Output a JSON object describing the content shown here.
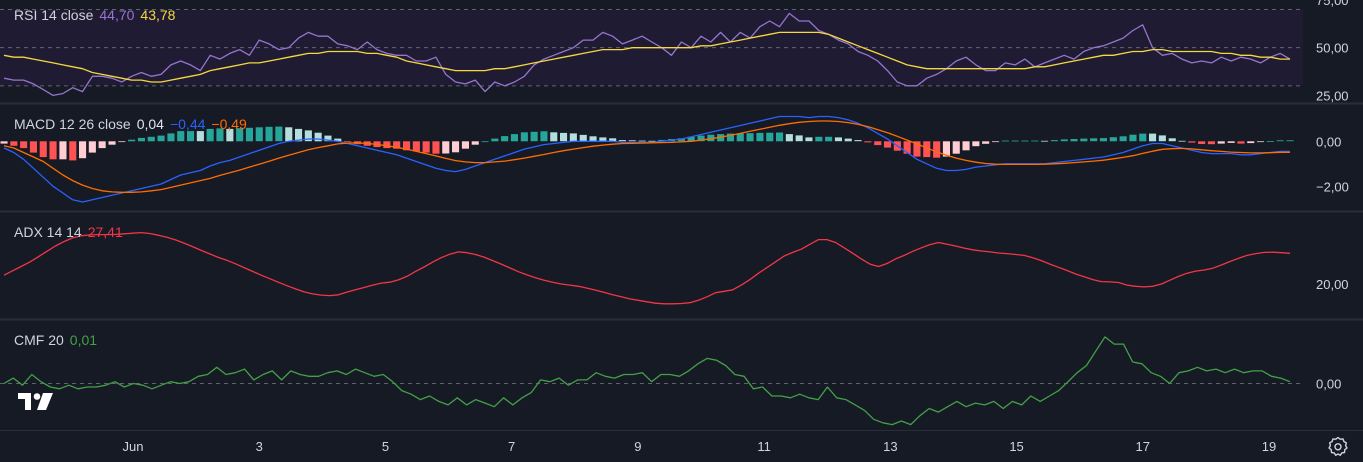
{
  "colors": {
    "background": "#161a25",
    "rsi_band": "#1f1b33",
    "rsi": "#9575cd",
    "rsi_ma": "#f5d93f",
    "macd": "#2962ff",
    "signal": "#ff6d00",
    "hist_pos_strong": "#26a69a",
    "hist_pos_weak": "#b2dfdb",
    "hist_neg_strong": "#ff5252",
    "hist_neg_weak": "#ffcdd2",
    "adx": "#f23645",
    "cmf": "#43a047",
    "axis_text": "#d1d4dc",
    "pane_divider": "#2a2e39"
  },
  "legends": {
    "rsi": {
      "name": "RSI 14 close",
      "v1": "44,70",
      "v2": "43,78"
    },
    "macd": {
      "name": "MACD 12 26 close",
      "v1": "0,04",
      "v2": "−0,44",
      "v3": "−0,49"
    },
    "adx": {
      "name": "ADX 14 14",
      "v1": "27,41"
    },
    "cmf": {
      "name": "CMF 20",
      "v1": "0,01"
    }
  },
  "icons": {
    "logo": "tradingview-logo-icon",
    "settings": "gear-icon"
  },
  "chart_data": [
    {
      "type": "line",
      "title": "RSI 14 close",
      "ylim": [
        21,
        75
      ],
      "y_ticks": [
        75,
        50,
        25
      ],
      "y_tick_labels": [
        "75,00",
        "50,00",
        "25,00"
      ],
      "bands": [
        70,
        50,
        30
      ],
      "series": [
        {
          "name": "RSI",
          "values": [
            34,
            33,
            33,
            31,
            28,
            25,
            26,
            29,
            27,
            35,
            35,
            34,
            32,
            35,
            37,
            35,
            36,
            41,
            43,
            41,
            38,
            46,
            44,
            47,
            49,
            46,
            54,
            52,
            49,
            50,
            55,
            58,
            56,
            56,
            52,
            51,
            49,
            53,
            49,
            47,
            46,
            46,
            43,
            43,
            45,
            36,
            32,
            31,
            33,
            27,
            32,
            30,
            32,
            35,
            41,
            44,
            46,
            48,
            50,
            54,
            54,
            58,
            56,
            52,
            54,
            56,
            53,
            50,
            46,
            53,
            50,
            56,
            53,
            58,
            53,
            58,
            55,
            61,
            64,
            61,
            68,
            64,
            64,
            59,
            57,
            54,
            52,
            48,
            46,
            43,
            38,
            32,
            30,
            30,
            34,
            36,
            39,
            43,
            45,
            41,
            38,
            38,
            42,
            41,
            44,
            40,
            42,
            44,
            46,
            44,
            48,
            50,
            51,
            53,
            55,
            59,
            62,
            50,
            46,
            47,
            44,
            42,
            43,
            42,
            45,
            43,
            45,
            44,
            42,
            45,
            47,
            44
          ]
        },
        {
          "name": "MA",
          "values": [
            46,
            45,
            45,
            44,
            43,
            42,
            41,
            40,
            39,
            37,
            36,
            35,
            34,
            33,
            33,
            32,
            32,
            33,
            34,
            35,
            36,
            38,
            39,
            40,
            41,
            42,
            42,
            43,
            44,
            45,
            46,
            47,
            47,
            48,
            48,
            48,
            48,
            47,
            47,
            46,
            45,
            43,
            42,
            41,
            40,
            39,
            38,
            38,
            38,
            38,
            39,
            39,
            40,
            41,
            42,
            43,
            44,
            45,
            46,
            47,
            48,
            49,
            49,
            49,
            50,
            50,
            50,
            50,
            50,
            50,
            50,
            51,
            51,
            52,
            53,
            54,
            55,
            56,
            57,
            58,
            58,
            58,
            58,
            58,
            57,
            55,
            53,
            51,
            49,
            47,
            45,
            43,
            41,
            40,
            39,
            39,
            39,
            39,
            39,
            39,
            39,
            39,
            39,
            39,
            39,
            40,
            40,
            41,
            42,
            43,
            44,
            45,
            46,
            46,
            47,
            48,
            48,
            49,
            49,
            48,
            48,
            48,
            48,
            48,
            47,
            47,
            46,
            46,
            45,
            45,
            44,
            44
          ]
        }
      ]
    },
    {
      "type": "line",
      "title": "MACD 12 26 close",
      "ylim": [
        -3.1,
        1.7
      ],
      "y_ticks": [
        0,
        -2
      ],
      "y_tick_labels": [
        "0,00",
        "−2,00"
      ],
      "series": [
        {
          "name": "MACD",
          "values": [
            -0.3,
            -0.5,
            -0.8,
            -1.2,
            -1.6,
            -2,
            -2.3,
            -2.6,
            -2.7,
            -2.6,
            -2.5,
            -2.4,
            -2.3,
            -2.2,
            -2.1,
            -2,
            -1.9,
            -1.7,
            -1.5,
            -1.4,
            -1.3,
            -1.1,
            -0.95,
            -0.85,
            -0.7,
            -0.55,
            -0.4,
            -0.25,
            -0.1,
            0.0,
            0.05,
            0.1,
            0.1,
            0.05,
            0.0,
            -0.1,
            -0.2,
            -0.3,
            -0.4,
            -0.5,
            -0.6,
            -0.75,
            -0.9,
            -1.05,
            -1.2,
            -1.3,
            -1.35,
            -1.25,
            -1.1,
            -0.95,
            -0.8,
            -0.65,
            -0.5,
            -0.35,
            -0.25,
            -0.15,
            -0.1,
            -0.05,
            0.0,
            0.0,
            0.0,
            0.0,
            0.0,
            -0.05,
            -0.05,
            -0.05,
            -0.05,
            0.0,
            0.05,
            0.1,
            0.2,
            0.3,
            0.4,
            0.5,
            0.6,
            0.7,
            0.8,
            0.9,
            1.0,
            1.1,
            1.1,
            1.1,
            1.05,
            1.1,
            1.1,
            1.05,
            0.95,
            0.8,
            0.6,
            0.35,
            0.1,
            -0.2,
            -0.5,
            -0.8,
            -1.0,
            -1.2,
            -1.3,
            -1.3,
            -1.25,
            -1.15,
            -1.1,
            -1.05,
            -1.0,
            -1.0,
            -1.0,
            -1.0,
            -1.0,
            -0.95,
            -0.9,
            -0.85,
            -0.8,
            -0.75,
            -0.7,
            -0.6,
            -0.5,
            -0.35,
            -0.2,
            -0.1,
            -0.1,
            -0.2,
            -0.3,
            -0.4,
            -0.5,
            -0.55,
            -0.55,
            -0.55,
            -0.6,
            -0.6,
            -0.55,
            -0.5,
            -0.45,
            -0.45
          ]
        },
        {
          "name": "Signal",
          "values": [
            -0.2,
            -0.3,
            -0.5,
            -0.7,
            -0.9,
            -1.2,
            -1.5,
            -1.75,
            -1.95,
            -2.1,
            -2.2,
            -2.25,
            -2.27,
            -2.27,
            -2.25,
            -2.2,
            -2.15,
            -2.05,
            -1.95,
            -1.85,
            -1.75,
            -1.65,
            -1.52,
            -1.4,
            -1.28,
            -1.15,
            -1.02,
            -0.89,
            -0.75,
            -0.62,
            -0.5,
            -0.38,
            -0.28,
            -0.2,
            -0.12,
            -0.08,
            -0.07,
            -0.1,
            -0.14,
            -0.2,
            -0.27,
            -0.35,
            -0.45,
            -0.55,
            -0.65,
            -0.76,
            -0.86,
            -0.92,
            -0.95,
            -0.95,
            -0.92,
            -0.88,
            -0.82,
            -0.75,
            -0.67,
            -0.59,
            -0.5,
            -0.42,
            -0.35,
            -0.28,
            -0.22,
            -0.17,
            -0.13,
            -0.1,
            -0.09,
            -0.08,
            -0.07,
            -0.06,
            -0.05,
            -0.03,
            0.0,
            0.05,
            0.11,
            0.18,
            0.26,
            0.35,
            0.44,
            0.53,
            0.62,
            0.71,
            0.78,
            0.84,
            0.88,
            0.9,
            0.9,
            0.88,
            0.83,
            0.75,
            0.65,
            0.52,
            0.38,
            0.22,
            0.05,
            -0.12,
            -0.3,
            -0.47,
            -0.62,
            -0.75,
            -0.85,
            -0.93,
            -0.99,
            -1.02,
            -1.03,
            -1.03,
            -1.03,
            -1.03,
            -1.02,
            -1.0,
            -0.98,
            -0.95,
            -0.92,
            -0.88,
            -0.84,
            -0.78,
            -0.72,
            -0.64,
            -0.54,
            -0.44,
            -0.36,
            -0.33,
            -0.32,
            -0.34,
            -0.38,
            -0.42,
            -0.45,
            -0.48,
            -0.5,
            -0.52,
            -0.52,
            -0.51,
            -0.49,
            -0.49
          ]
        }
      ]
    },
    {
      "type": "line",
      "title": "ADX 14 14",
      "ylim": [
        8,
        45
      ],
      "y_ticks": [
        20
      ],
      "y_tick_labels": [
        "20,00"
      ],
      "series": [
        {
          "name": "ADX",
          "values": [
            23,
            24.5,
            26,
            27.5,
            29.3,
            31.2,
            33,
            34.5,
            35.8,
            36.5,
            36.8,
            36.9,
            36.9,
            37.0,
            37.2,
            37.4,
            37.6,
            37.3,
            36.7,
            36.0,
            35.1,
            34.0,
            32.8,
            31.5,
            30.3,
            29.1,
            28.1,
            26.9,
            25.6,
            24.3,
            23.0,
            21.8,
            20.6,
            19.4,
            18.3,
            17.3,
            16.6,
            16.2,
            16.0,
            16.3,
            17.2,
            18.0,
            18.8,
            19.6,
            20.3,
            20.6,
            21.4,
            22.6,
            24.3,
            25.8,
            27.5,
            29.0,
            30.2,
            31.0,
            30.7,
            30.1,
            29.2,
            28.0,
            26.8,
            25.5,
            24.2,
            23.1,
            22.1,
            21.3,
            20.6,
            20.0,
            19.6,
            19.2,
            18.6,
            17.9,
            17.1,
            16.3,
            15.6,
            14.9,
            14.4,
            13.9,
            13.4,
            13.2,
            13.2,
            13.3,
            13.6,
            14.4,
            15.6,
            17.0,
            17.5,
            18.0,
            19.6,
            21.5,
            23.7,
            25.6,
            27.6,
            29.6,
            30.8,
            31.9,
            33.6,
            35.2,
            35.2,
            34.2,
            32.4,
            30.5,
            28.6,
            26.8,
            26.0,
            27.0,
            28.6,
            29.8,
            31.2,
            32.4,
            33.5,
            34.2,
            33.6,
            33.0,
            32.3,
            31.7,
            31.3,
            31.0,
            30.6,
            30.4,
            30.1,
            29.8,
            29.0,
            28.0,
            26.8,
            25.7,
            24.6,
            23.4,
            22.5,
            21.5,
            20.8,
            20.7,
            20.5,
            19.6,
            19.2,
            19.0,
            19.2,
            20.0,
            21.3,
            22.6,
            23.7,
            24.4,
            24.8,
            25.4,
            26.5,
            27.7,
            28.8,
            29.8,
            30.4,
            30.8,
            30.9,
            30.7,
            30.5
          ]
        }
      ]
    },
    {
      "type": "line",
      "title": "CMF 20",
      "ylim": [
        -0.26,
        0.36
      ],
      "y_ticks": [
        0
      ],
      "y_tick_labels": [
        "0,00"
      ],
      "series": [
        {
          "name": "CMF",
          "values": [
            0.0,
            0.03,
            -0.01,
            0.05,
            0.01,
            -0.02,
            -0.03,
            -0.01,
            -0.03,
            -0.02,
            -0.02,
            -0.01,
            0.01,
            -0.02,
            0.0,
            -0.01,
            -0.03,
            -0.01,
            0.01,
            0.0,
            0.01,
            0.04,
            0.05,
            0.09,
            0.05,
            0.06,
            0.08,
            0.02,
            0.05,
            0.07,
            0.02,
            0.07,
            0.05,
            0.04,
            0.04,
            0.06,
            0.07,
            0.05,
            0.08,
            0.06,
            0.04,
            0.05,
            0.01,
            -0.04,
            -0.06,
            -0.09,
            -0.07,
            -0.1,
            -0.12,
            -0.08,
            -0.12,
            -0.09,
            -0.11,
            -0.13,
            -0.08,
            -0.12,
            -0.08,
            -0.05,
            0.02,
            0.01,
            0.03,
            -0.01,
            0.02,
            0.02,
            0.06,
            0.04,
            0.03,
            0.05,
            0.05,
            0.06,
            0.01,
            0.05,
            0.05,
            0.04,
            0.07,
            0.11,
            0.14,
            0.13,
            0.1,
            0.05,
            0.04,
            -0.03,
            -0.02,
            -0.07,
            -0.07,
            -0.08,
            -0.06,
            -0.08,
            -0.09,
            -0.02,
            -0.08,
            -0.09,
            -0.12,
            -0.15,
            -0.2,
            -0.22,
            -0.23,
            -0.21,
            -0.23,
            -0.18,
            -0.14,
            -0.16,
            -0.13,
            -0.1,
            -0.13,
            -0.11,
            -0.12,
            -0.1,
            -0.14,
            -0.1,
            -0.12,
            -0.07,
            -0.1,
            -0.07,
            -0.04,
            0.01,
            0.06,
            0.1,
            0.18,
            0.26,
            0.22,
            0.22,
            0.12,
            0.11,
            0.06,
            0.04,
            0.0,
            0.06,
            0.07,
            0.09,
            0.07,
            0.08,
            0.06,
            0.08,
            0.06,
            0.07,
            0.07,
            0.04,
            0.03,
            0.01
          ]
        }
      ]
    }
  ],
  "x_axis": {
    "labels": [
      "Jun",
      "3",
      "5",
      "7",
      "9",
      "11",
      "13",
      "15",
      "17",
      "19"
    ]
  }
}
